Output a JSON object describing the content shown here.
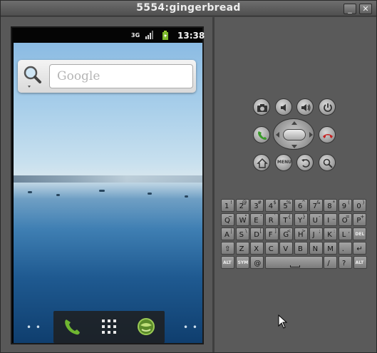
{
  "window": {
    "title": "5554:gingerbread",
    "min_label": "_",
    "close_label": "✕"
  },
  "status_bar": {
    "network": "3G",
    "time": "13:38"
  },
  "search_widget": {
    "placeholder": "Google"
  },
  "colors": {
    "wallpaper_sky": "#a9cfea",
    "wallpaper_water": "#1f5a91",
    "chrome": "#5a5a5a"
  },
  "keyboard": {
    "rows": [
      [
        [
          "1",
          "!"
        ],
        [
          "2",
          "@"
        ],
        [
          "3",
          "#"
        ],
        [
          "4",
          "$"
        ],
        [
          "5",
          "%"
        ],
        [
          "6",
          "^"
        ],
        [
          "7",
          "&"
        ],
        [
          "8",
          "*"
        ],
        [
          "9",
          "("
        ],
        [
          "0",
          ")"
        ]
      ],
      [
        [
          "Q",
          "~"
        ],
        [
          "W",
          "\""
        ],
        [
          "E",
          "'"
        ],
        [
          "R",
          "`"
        ],
        [
          "T",
          "{"
        ],
        [
          "Y",
          "}"
        ],
        [
          "U",
          "-"
        ],
        [
          "I",
          "_"
        ],
        [
          "O",
          "="
        ],
        [
          "P",
          "+"
        ]
      ],
      [
        [
          "A",
          "|"
        ],
        [
          "S",
          "\\"
        ],
        [
          "D",
          "["
        ],
        [
          "F",
          "]"
        ],
        [
          "G",
          "<"
        ],
        [
          "H",
          ">"
        ],
        [
          "J",
          ";"
        ],
        [
          "K",
          ":"
        ],
        [
          "L",
          ","
        ],
        [
          "DEL",
          ""
        ]
      ],
      [
        [
          "⇧",
          ""
        ],
        [
          "Z",
          ""
        ],
        [
          "X",
          ""
        ],
        [
          "C",
          ""
        ],
        [
          "V",
          ""
        ],
        [
          "B",
          ""
        ],
        [
          "N",
          ""
        ],
        [
          "M",
          ""
        ],
        [
          ".",
          ""
        ],
        [
          "↵",
          ""
        ]
      ]
    ],
    "bottom": {
      "alt_left": "ALT",
      "sym": "SYM",
      "at": "@",
      "slash": "/",
      "question": "?",
      "comma": ",",
      "alt_right": "ALT"
    }
  },
  "icons": [
    "camera-icon",
    "volume-down-icon",
    "volume-up-icon",
    "power-icon",
    "call-icon",
    "dpad-icon",
    "end-call-icon",
    "home-icon",
    "menu-icon",
    "back-icon",
    "search-icon"
  ],
  "dock": {
    "items": [
      "phone-icon",
      "app-drawer-icon",
      "browser-icon"
    ]
  },
  "misc": {
    "menu_label": "MENU"
  }
}
